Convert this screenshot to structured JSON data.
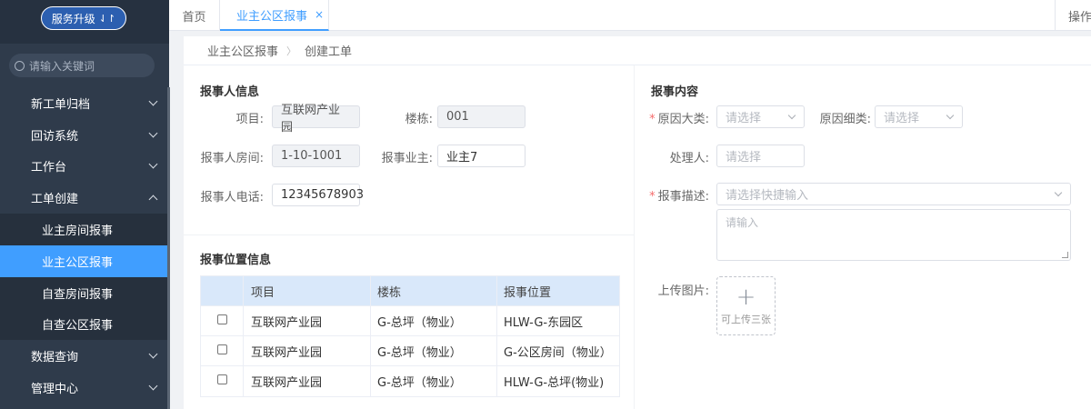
{
  "sidebar": {
    "upgrade_label": "服务升级",
    "upgrade_icon": "⇃↾",
    "search_placeholder": "请输入关键词",
    "items": [
      {
        "label": "新工单归档"
      },
      {
        "label": "回访系统"
      },
      {
        "label": "工作台"
      },
      {
        "label": "工单创建"
      },
      {
        "label": "业主房间报事"
      },
      {
        "label": "业主公区报事"
      },
      {
        "label": "自查房间报事"
      },
      {
        "label": "自查公区报事"
      },
      {
        "label": "数据查询"
      },
      {
        "label": "管理中心"
      }
    ]
  },
  "tabs": {
    "home": "首页",
    "active": "业主公区报事",
    "close": "×",
    "ops": "操作"
  },
  "breadcrumb": {
    "parent": "业主公区报事",
    "sep": "〉",
    "current": "创建工单"
  },
  "reporter": {
    "title": "报事人信息",
    "project_label": "项目:",
    "project_value": "互联网产业园",
    "building_label": "楼栋:",
    "building_value": "001",
    "room_label": "报事人房间:",
    "room_value": "1-10-1001",
    "owner_label": "报事业主:",
    "owner_value": "业主7",
    "phone_label": "报事人电话:",
    "phone_value": "12345678903"
  },
  "location": {
    "title": "报事位置信息",
    "columns": [
      "项目",
      "楼栋",
      "报事位置"
    ],
    "rows": [
      [
        "互联网产业园",
        "G-总坪（物业）",
        "HLW-G-东园区"
      ],
      [
        "互联网产业园",
        "G-总坪（物业）",
        "G-公区房间（物业）"
      ],
      [
        "互联网产业园",
        "G-总坪（物业）",
        "HLW-G-总坪(物业)"
      ]
    ]
  },
  "content": {
    "title": "报事内容",
    "required_mark": "*",
    "cause_major_label": "原因大类:",
    "cause_major_placeholder": "请选择",
    "cause_minor_label": "原因细类:",
    "cause_minor_placeholder": "请选择",
    "handler_label": "处理人:",
    "handler_placeholder": "请选择",
    "desc_label": "报事描述:",
    "desc_quick_placeholder": "请选择快捷输入",
    "desc_placeholder": "请输入",
    "upload_label": "上传图片:",
    "upload_plus": "+",
    "upload_hint": "可上传三张"
  }
}
